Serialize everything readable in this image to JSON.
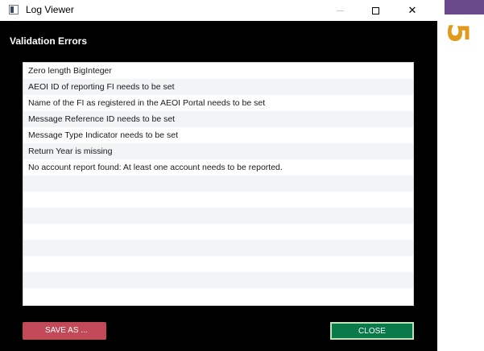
{
  "window": {
    "title": "Log Viewer",
    "dialog_title": "Validation Errors"
  },
  "errors": [
    "Zero length BigInteger",
    "AEOI ID of reporting FI needs to be set",
    "Name of the FI as registered in the AEOI Portal needs to be set",
    "Message Reference ID needs to be set",
    "Message Type Indicator needs to be set",
    "Return Year is missing",
    "No account report found: At least one account needs to be reported.",
    "",
    "",
    "",
    "",
    "",
    "",
    "",
    ""
  ],
  "buttons": {
    "save_as": "SAVE AS ...",
    "close": "CLOSE"
  },
  "side": {
    "number": "5"
  },
  "colors": {
    "save_button": "#c24a58",
    "close_button": "#0a7a4a",
    "side_number": "#e19a1b",
    "side_bar": "#6b4a8c"
  },
  "icons": [
    "app-window-icon",
    "minimize-icon",
    "maximize-icon",
    "close-icon"
  ]
}
